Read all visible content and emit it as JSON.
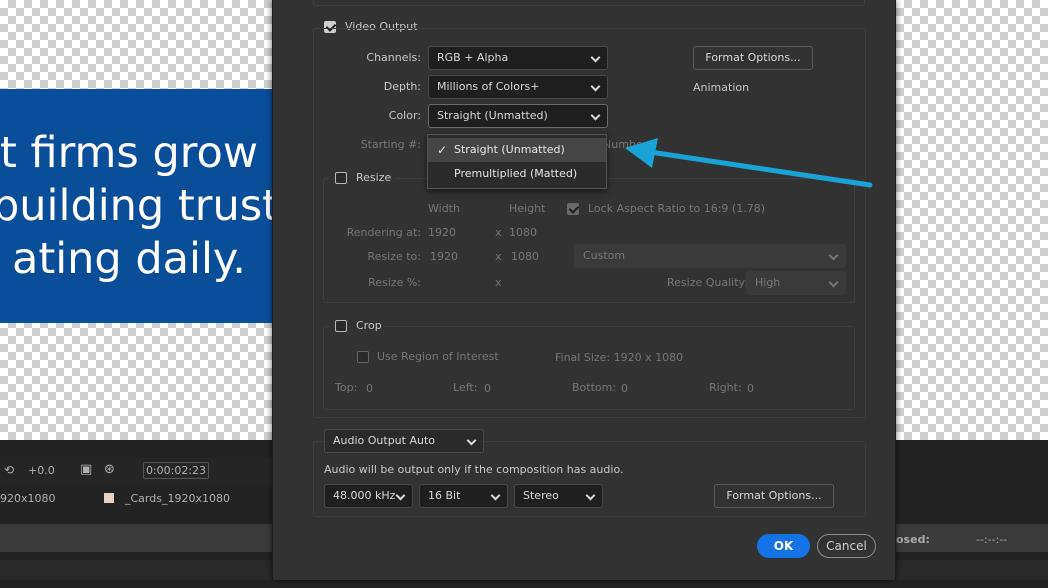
{
  "background_comp": {
    "card_lines": [
      "t firms grow",
      "building trust",
      "ating daily."
    ]
  },
  "timeline": {
    "offset": "+0.0",
    "timecode": "0:00:02:23",
    "row_left": "920x1080",
    "row_comp": "_Cards_1920x1080",
    "elapsed_label": "osed:",
    "elapsed_value": "--:--:--"
  },
  "video_output": {
    "label": "Video Output",
    "checked": true,
    "channels_label": "Channels:",
    "channels_value": "RGB + Alpha",
    "depth_label": "Depth:",
    "depth_value": "Millions of Colors+",
    "color_label": "Color:",
    "color_value": "Straight (Unmatted)",
    "starting_label": "Starting #:",
    "starting_suffix": "Number",
    "format_options_button": "Format Options...",
    "codec_label": "Animation"
  },
  "color_dropdown": {
    "options": [
      "Straight (Unmatted)",
      "Premultiplied (Matted)"
    ],
    "selected": "Straight (Unmatted)",
    "check_glyph": "✓"
  },
  "resize": {
    "label": "Resize",
    "checked": false,
    "width_header": "Width",
    "height_header": "Height",
    "lock_aspect_label": "Lock Aspect Ratio to 16:9 (1.78)",
    "rendering_at_label": "Rendering at:",
    "rendering_w": "1920",
    "rendering_x": "x",
    "rendering_h": "1080",
    "resize_to_label": "Resize to:",
    "resize_w": "1920",
    "resize_x": "x",
    "resize_h": "1080",
    "preset_value": "Custom",
    "resize_pct_label": "Resize %:",
    "resize_pct_x": "x",
    "quality_label": "Resize Quality:",
    "quality_value": "High"
  },
  "crop": {
    "label": "Crop",
    "checked": false,
    "roi_label": "Use Region of Interest",
    "final_size": "Final Size: 1920 x 1080",
    "top_label": "Top:",
    "top_value": "0",
    "left_label": "Left:",
    "left_value": "0",
    "bottom_label": "Bottom:",
    "bottom_value": "0",
    "right_label": "Right:",
    "right_value": "0"
  },
  "audio": {
    "output_select": "Audio Output Auto",
    "note": "Audio will be output only if the composition has audio.",
    "sample_rate": "48.000 kHz",
    "bit_depth": "16 Bit",
    "channels": "Stereo",
    "format_options_button": "Format Options..."
  },
  "footer": {
    "ok": "OK",
    "cancel": "Cancel"
  },
  "colors": {
    "accent": "#1473e6",
    "annotation_arrow": "#1aa3d6",
    "card_blue": "#0a4e9a",
    "dialog_bg": "#323232"
  }
}
